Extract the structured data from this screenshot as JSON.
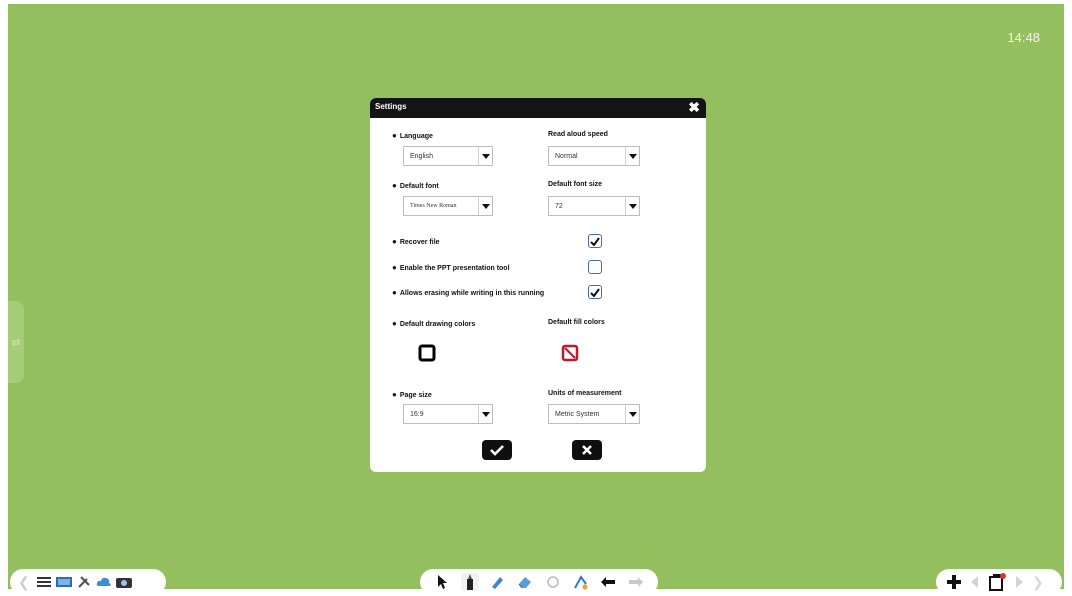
{
  "clock": "14:48",
  "dialog": {
    "title": "Settings",
    "close_glyph": "✖",
    "language": {
      "label": "Language",
      "value": "English"
    },
    "read_speed": {
      "label": "Read aloud speed",
      "value": "Normal"
    },
    "default_font": {
      "label": "Default font",
      "value": "Times New Roman"
    },
    "font_size": {
      "label": "Default font size",
      "value": "72"
    },
    "recover_file": {
      "label": "Recover file",
      "checked": true
    },
    "ppt_tool": {
      "label": "Enable the PPT presentation tool",
      "checked": false
    },
    "allow_erasing": {
      "label": "Allows erasing while writing in this running",
      "checked": true
    },
    "drawing_colors": {
      "label": "Default drawing colors",
      "color": "#000000"
    },
    "fill_colors": {
      "label": "Default fill colors",
      "color": "#c0192b"
    },
    "page_size": {
      "label": "Page size",
      "value": "16:9"
    },
    "units": {
      "label": "Units of measurement",
      "value": "Metric System"
    }
  },
  "colors": {
    "desktop": "#93bf5f",
    "titlebar": "#141414",
    "checkbox_border": "#4c6aa8",
    "fill_none": "#c0192b"
  },
  "icons": {
    "left_toolbar": [
      "menu-icon",
      "screen-icon",
      "tools-icon",
      "cloud-icon",
      "camera-icon"
    ],
    "center_toolbar": [
      "cursor-icon",
      "pen-icon",
      "highlighter-icon",
      "eraser-icon",
      "lasso-icon",
      "shapes-icon",
      "undo-icon",
      "redo-icon"
    ],
    "right_toolbar": [
      "add-page-icon",
      "prev-page-icon",
      "page-count-icon",
      "next-page-icon"
    ]
  }
}
